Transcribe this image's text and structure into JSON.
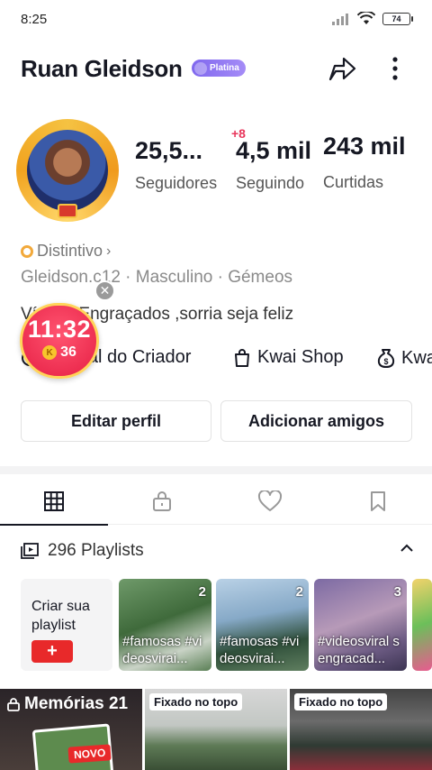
{
  "status_bar": {
    "time": "8:25",
    "battery": "74"
  },
  "header": {
    "name": "Ruan Gleidson",
    "badge": "Platina"
  },
  "stats": {
    "followers": {
      "value": "25,5...",
      "label": "Seguidores"
    },
    "following": {
      "value": "4,5 mil",
      "label": "Seguindo",
      "delta": "+8"
    },
    "likes": {
      "value": "243 mil",
      "label": "Curtidas"
    }
  },
  "profile": {
    "badge_label": "Distintivo",
    "info": "Gleidson.c12 · Masculino · Gémeos",
    "bio": "Vídeos Engraçados ,sorria seja feliz"
  },
  "links": [
    {
      "label": "Central do Criador"
    },
    {
      "label": "Kwai Shop"
    },
    {
      "label": "Kwai"
    }
  ],
  "timer": {
    "time": "11:32",
    "coins": "36",
    "coin_symbol": "K"
  },
  "buttons": {
    "edit": "Editar perfil",
    "add": "Adicionar amigos"
  },
  "playlists": {
    "header": "296 Playlists",
    "create_label": "Criar sua playlist",
    "create_plus": "+",
    "items": [
      {
        "count": "2",
        "title": "#famosas #videosvirai..."
      },
      {
        "count": "2",
        "title": "#famosas #videosvirai..."
      },
      {
        "count": "3",
        "title": "#videosviral sengracad..."
      }
    ]
  },
  "grid": {
    "memories": "Memórias 21",
    "novo": "NOVO",
    "pinned": [
      "Fixado no topo",
      "Fixado no topo"
    ]
  },
  "colors": {
    "accent": "#e8292a",
    "platina": "#8b72f0",
    "delta": "#e8365b"
  }
}
